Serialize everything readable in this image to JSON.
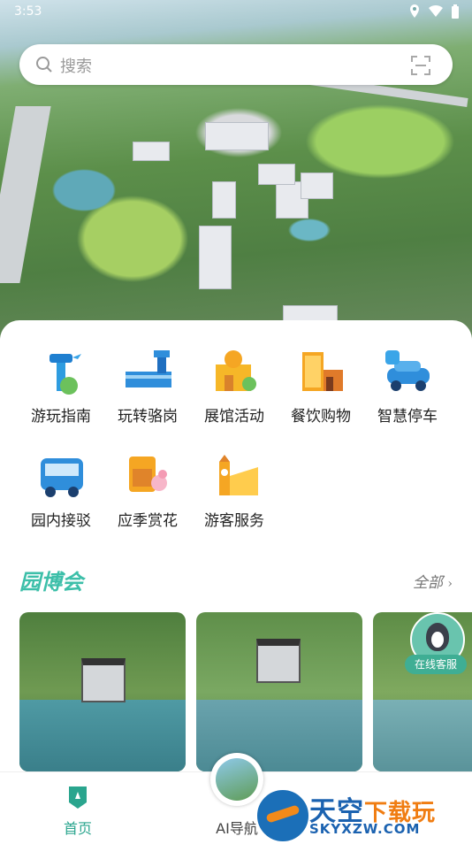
{
  "status": {
    "time": "3:53"
  },
  "search": {
    "placeholder": "搜索"
  },
  "services": [
    {
      "label": "游玩指南",
      "icon": "tower-icon"
    },
    {
      "label": "玩转骆岗",
      "icon": "airport-icon"
    },
    {
      "label": "展馆活动",
      "icon": "exhibition-icon"
    },
    {
      "label": "餐饮购物",
      "icon": "mall-icon"
    },
    {
      "label": "智慧停车",
      "icon": "parking-icon"
    },
    {
      "label": "园内接驳",
      "icon": "bus-icon"
    },
    {
      "label": "应季赏花",
      "icon": "flower-icon"
    },
    {
      "label": "游客服务",
      "icon": "clock-tower-icon"
    }
  ],
  "section": {
    "title": "园博会",
    "more": "全部"
  },
  "online_service": {
    "label": "在线客服"
  },
  "nav": {
    "home": "首页",
    "ai": "AI导航"
  },
  "watermark": {
    "brand_main": "天空",
    "brand_sub": "下载玩",
    "url": "SKYXZW.COM"
  },
  "colors": {
    "accent": "#3dbfa9",
    "nav_active": "#2aa58e"
  }
}
